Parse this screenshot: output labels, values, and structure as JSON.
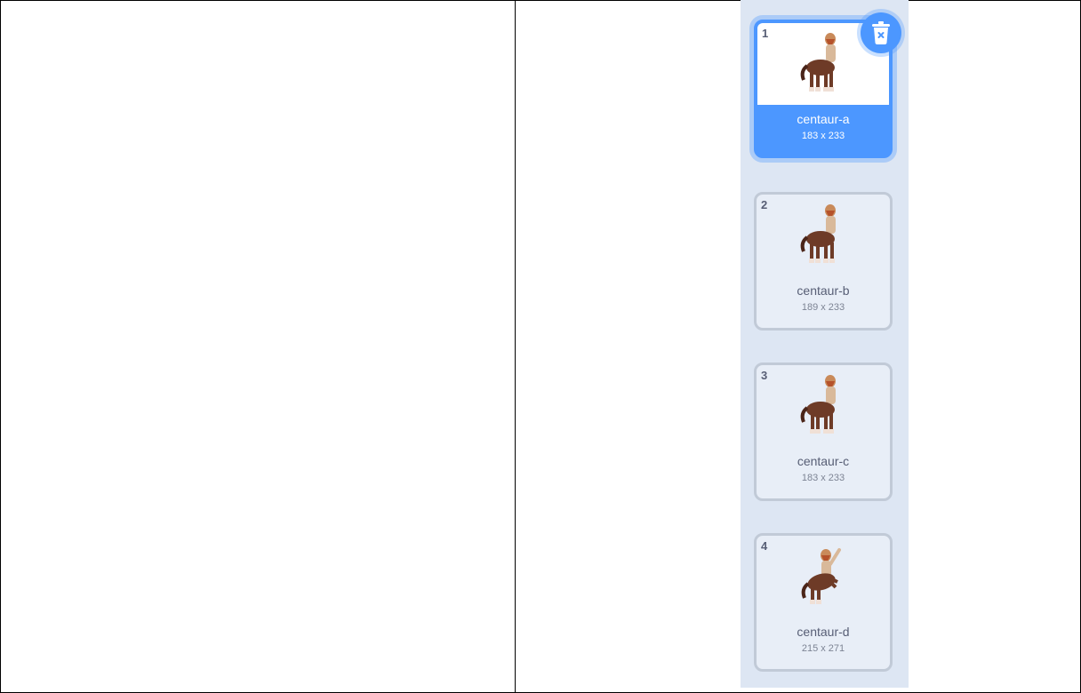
{
  "costumes": [
    {
      "number": "1",
      "name": "centaur-a",
      "size": "183 x 233",
      "selected": true
    },
    {
      "number": "2",
      "name": "centaur-b",
      "size": "189 x 233",
      "selected": false
    },
    {
      "number": "3",
      "name": "centaur-c",
      "size": "183 x 233",
      "selected": false
    },
    {
      "number": "4",
      "name": "centaur-d",
      "size": "215 x 271",
      "selected": false
    }
  ],
  "icons": {
    "delete": "trash-can-icon",
    "thumbnail": "centaur-sprite-icon"
  },
  "colors": {
    "accent": "#4c97ff",
    "strip_background": "#dde6f3",
    "tile_border": "#c1cad7",
    "text": "#575e75"
  }
}
